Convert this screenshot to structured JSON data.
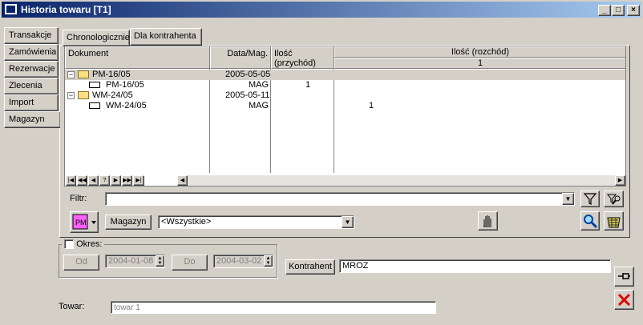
{
  "window": {
    "title": "Historia towaru [T1]"
  },
  "side_tabs": [
    "Transakcje",
    "Zamówienia",
    "Rezerwacje",
    "Zlecenia",
    "Import",
    "Magazyn"
  ],
  "tabs": [
    "Chronologicznie",
    "Dla kontrahenta"
  ],
  "grid": {
    "columns": [
      "Dokument",
      "Data/Mag.",
      "Ilość (przychód)",
      "Ilość (rozchód)"
    ],
    "rozchod_sub": "1",
    "rows": [
      {
        "doc": "PM-16/05",
        "date": "2005-05-05",
        "in": "",
        "out": "",
        "level": 0
      },
      {
        "doc": "PM-16/05",
        "date": "MAG",
        "in": "1",
        "out": "",
        "level": 1
      },
      {
        "doc": "WM-24/05",
        "date": "2005-05-11",
        "in": "",
        "out": "",
        "level": 0
      },
      {
        "doc": "WM-24/05",
        "date": "MAG",
        "in": "",
        "out": "1",
        "level": 1
      }
    ],
    "tree_minus": "−"
  },
  "nav": [
    "|◀",
    "◀◀",
    "◀",
    "?",
    "▶",
    "▶▶",
    "▶|"
  ],
  "filter": {
    "label": "Filtr:",
    "value": ""
  },
  "magazyn": {
    "button": "Magazyn",
    "value": "<Wszystkie>"
  },
  "okres": {
    "label": "Okres:",
    "od": "Od",
    "od_value": "2004-01-08",
    "do": "Do",
    "do_value": "2004-03-02"
  },
  "kontrahent": {
    "button": "Kontrahent",
    "value": "MROZ"
  },
  "towar": {
    "label": "Towar:",
    "value": "towar 1"
  },
  "icons": {
    "pm": "PM",
    "filter": "funnel-icon",
    "filter_edit": "filter-edit-icon",
    "search": "magnifier-icon",
    "basket": "basket-icon",
    "hand": "hand-icon",
    "pin": "pin-icon",
    "close": "close-icon"
  }
}
